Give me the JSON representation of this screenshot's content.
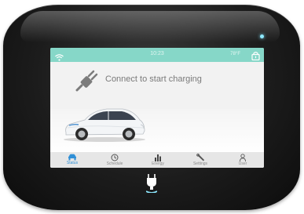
{
  "device": {
    "led_color": "#8ee9ff",
    "connector_icon": "plug-connector-icon"
  },
  "screen": {
    "top_bar": {
      "wifi_icon": "wifi-icon",
      "time": "10:23",
      "temperature": "78°F",
      "lock_icon": "lock-icon",
      "color": "#86d7c8"
    },
    "message": {
      "icon": "plug-icon",
      "text": "Connect to start charging"
    },
    "car_image": "car-image",
    "nav": [
      {
        "label": "Status",
        "icon": "car-icon",
        "active": true
      },
      {
        "label": "Schedule",
        "icon": "clock-icon",
        "active": false
      },
      {
        "label": "Energy",
        "icon": "bar-chart-icon",
        "active": false
      },
      {
        "label": "Settings",
        "icon": "wrench-icon",
        "active": false
      },
      {
        "label": "User",
        "icon": "user-icon",
        "active": false
      }
    ],
    "accent": "#2f8fd6"
  }
}
